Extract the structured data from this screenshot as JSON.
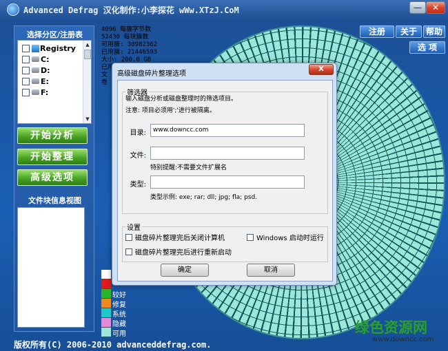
{
  "window": {
    "title": "Advanced Defrag  汉化制作:小李探花 wWw.XTzJ.CoM",
    "minimize_glyph": "—",
    "close_glyph": "✕"
  },
  "left_panel": {
    "partition_title": "选择分区/注册表",
    "drives": [
      {
        "label": "Registry",
        "icon": "registry-icon"
      },
      {
        "label": "C:",
        "icon": "drive-icon"
      },
      {
        "label": "D:",
        "icon": "drive-icon"
      },
      {
        "label": "E:",
        "icon": "drive-icon"
      },
      {
        "label": "F:",
        "icon": "drive-icon"
      }
    ],
    "analyze_label": "开始分析",
    "defrag_label": "开始整理",
    "advanced_label": "高级选项",
    "block_view_title": "文件块信息视图"
  },
  "top_buttons": {
    "register": "注册",
    "about": "关于",
    "help": "帮助",
    "options": "选 项"
  },
  "disk_info": {
    "lines": [
      "4096 每簇字节数",
      "52430 每块簇数",
      "可用簇: 30982362",
      "已用簇: 21446593",
      "大小: 200.0 GB",
      "已用: 81.8 GB",
      "文",
      "卷"
    ]
  },
  "legend": {
    "items": [
      {
        "label": "",
        "color": "#ffffff"
      },
      {
        "label": "",
        "color": "#e01a1a"
      },
      {
        "label": "较好",
        "color": "#2bb52b"
      },
      {
        "label": "修复",
        "color": "#f08a1e"
      },
      {
        "label": "系统",
        "color": "#1ec8c8"
      },
      {
        "label": "隐藏",
        "color": "#e58ad8"
      },
      {
        "label": "可用",
        "color": "#9ee6da"
      }
    ]
  },
  "footer": {
    "copyright": "版权所有(C) 2006-2010 advanceddefrag.com."
  },
  "watermark": {
    "brand": "绿色资源网",
    "url": "www.downcc.com"
  },
  "dialog": {
    "title": "高级磁盘碎片整理选项",
    "close_glyph": "X",
    "filter_group_title": "筛选器",
    "filter_desc": "输入磁盘分析或磁盘整理时的筛选项目。",
    "filter_note": "注意: 项目必须用';'进行被隔离。",
    "dir_label": "目录:",
    "dir_value": "www.downcc.com",
    "file_label": "文件:",
    "file_value": "",
    "file_hint": "特别提醒:不需要文件扩展名",
    "type_label": "类型:",
    "type_value": "",
    "type_hint": "类型示例: exe; rar; dll; jpg; fla; psd.",
    "settings_group_title": "设置",
    "opt_shutdown": "磁盘碎片整理完后关闭计算机",
    "opt_startup": "Windows 启动时运行",
    "opt_restart": "磁盘碎片整理完后进行重新启动",
    "ok_label": "确定",
    "cancel_label": "取消"
  }
}
